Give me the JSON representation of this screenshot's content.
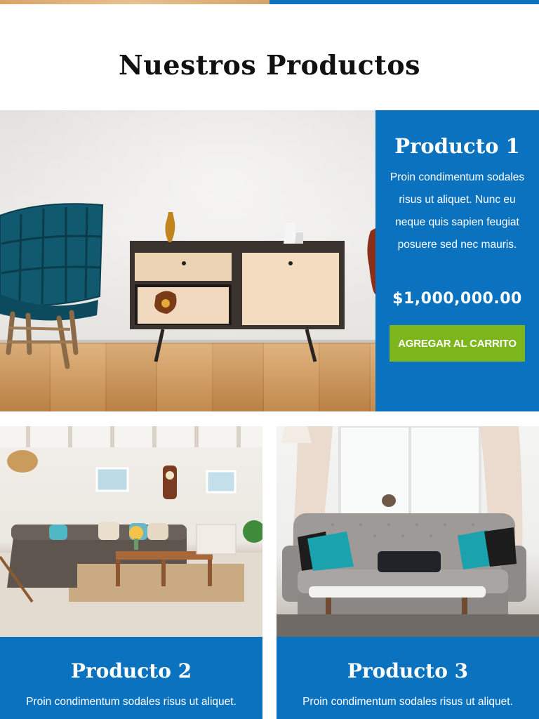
{
  "section": {
    "title": "Nuestros Productos"
  },
  "featured": {
    "title": "Producto 1",
    "description": "Proin condimentum sodales risus ut aliquet. Nunc eu neque quis sapien feugiat posuere sed nec mauris.",
    "price": "$1,000,000.00",
    "button_label": "AGREGAR AL CARRITO"
  },
  "products": [
    {
      "title": "Producto 2",
      "description": "Proin condimentum sodales risus ut aliquet."
    },
    {
      "title": "Producto 3",
      "description": "Proin condimentum sodales risus ut aliquet."
    }
  ],
  "colors": {
    "brand_blue": "#0a72bf",
    "cart_green": "#7db61c",
    "text_dark": "#111111"
  }
}
